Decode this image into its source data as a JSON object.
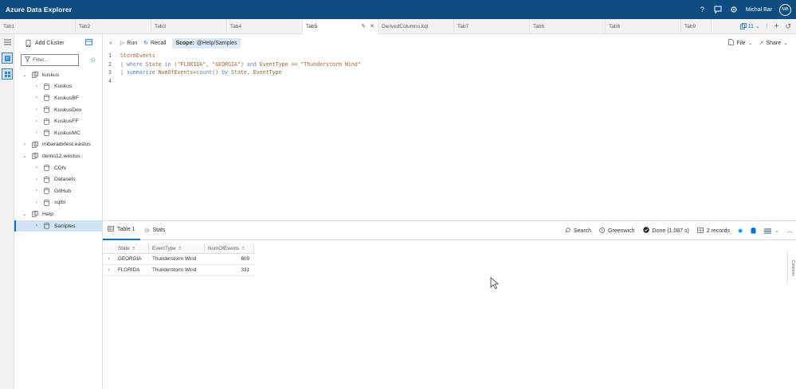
{
  "app": {
    "title": "Azure Data Explorer",
    "user_name": "Michal Bar",
    "user_initials": "MB"
  },
  "header_icons": [
    "help-icon",
    "feedback-icon",
    "settings-icon"
  ],
  "tabs": [
    {
      "label": "Tab1"
    },
    {
      "label": "Tab2"
    },
    {
      "label": "Tab3"
    },
    {
      "label": "Tab4"
    },
    {
      "label": "Tab5"
    },
    {
      "label": "DerivedColumns.kql"
    },
    {
      "label": "Tab7"
    },
    {
      "label": "Tab6"
    },
    {
      "label": "Tab8"
    },
    {
      "label": "Tab9"
    }
  ],
  "tab_tools": {
    "count": "11"
  },
  "connections": {
    "add_cluster_label": "Add Cluster",
    "filter_placeholder": "Filter...",
    "tree": [
      {
        "label": "kuskus",
        "level": 0,
        "expanded": true,
        "kind": "cluster"
      },
      {
        "label": "Kuskus",
        "level": 1,
        "expanded": false,
        "kind": "db"
      },
      {
        "label": "KuskusBF",
        "level": 1,
        "expanded": false,
        "kind": "db"
      },
      {
        "label": "KuskusDev",
        "level": 1,
        "expanded": false,
        "kind": "db"
      },
      {
        "label": "KuskusFF",
        "level": 1,
        "expanded": false,
        "kind": "db"
      },
      {
        "label": "KuskusMC",
        "level": 1,
        "expanded": false,
        "kind": "db"
      },
      {
        "label": "mibaradxtest.eastus",
        "level": 0,
        "expanded": false,
        "kind": "cluster"
      },
      {
        "label": "demo12.westus",
        "level": 0,
        "expanded": true,
        "kind": "cluster"
      },
      {
        "label": "CDN",
        "level": 1,
        "expanded": false,
        "kind": "db"
      },
      {
        "label": "Datasets",
        "level": 1,
        "expanded": false,
        "kind": "db"
      },
      {
        "label": "GitHub",
        "level": 1,
        "expanded": false,
        "kind": "db"
      },
      {
        "label": "sqlbi",
        "level": 1,
        "expanded": false,
        "kind": "db"
      },
      {
        "label": "Help",
        "level": 0,
        "expanded": true,
        "kind": "cluster"
      },
      {
        "label": "Samples",
        "level": 1,
        "expanded": false,
        "kind": "db",
        "selected": true
      }
    ]
  },
  "toolbar": {
    "run_label": "Run",
    "recall_label": "Recall",
    "scope_prefix": "Scope:",
    "scope_value": "@Help/Samples",
    "file_label": "File",
    "share_label": "Share"
  },
  "editor": {
    "lines": [
      {
        "num": "1",
        "tokens": [
          {
            "t": "StormEvents",
            "c": "kw-t"
          }
        ]
      },
      {
        "num": "2",
        "tokens": [
          {
            "t": "| ",
            "c": "kw-o"
          },
          {
            "t": "where",
            "c": "kw-k"
          },
          {
            "t": " State ",
            "c": "kw-o"
          },
          {
            "t": "in",
            "c": "kw-k"
          },
          {
            "t": " (",
            "c": "kw-o"
          },
          {
            "t": "\"FLORIDA\"",
            "c": "kw-s"
          },
          {
            "t": ", ",
            "c": "kw-o"
          },
          {
            "t": "\"GEORGIA\"",
            "c": "kw-s"
          },
          {
            "t": ") ",
            "c": "kw-o"
          },
          {
            "t": "and",
            "c": "kw-k"
          },
          {
            "t": " EventType == ",
            "c": "kw-o"
          },
          {
            "t": "\"Thunderstorm Wind\"",
            "c": "kw-s"
          }
        ]
      },
      {
        "num": "3",
        "tokens": [
          {
            "t": "| ",
            "c": "kw-o"
          },
          {
            "t": "summarize",
            "c": "kw-k"
          },
          {
            "t": " NumOfEvents=",
            "c": "kw-o"
          },
          {
            "t": "count",
            "c": "kw-f"
          },
          {
            "t": "() ",
            "c": "kw-o"
          },
          {
            "t": "by",
            "c": "kw-k"
          },
          {
            "t": " State, EventType",
            "c": "kw-o"
          }
        ]
      },
      {
        "num": "4",
        "tokens": []
      }
    ]
  },
  "results": {
    "tabs": [
      {
        "label": "Table 1"
      },
      {
        "label": "Stats"
      }
    ],
    "search_label": "Search",
    "timezone_label": "Greenwich",
    "status_label": "Done (1.087 s)",
    "records_label": "2 records",
    "columns_pane_label": "Columns",
    "columns": [
      "State",
      "EventType",
      "NumOfEvents"
    ],
    "rows": [
      [
        "GEORGIA",
        "Thunderstorm Wind",
        "609"
      ],
      [
        "FLORIDA",
        "Thunderstorm Wind",
        "331"
      ]
    ]
  },
  "colors": {
    "header": "#0f4c81",
    "accent": "#0078d4",
    "selection": "#cfe3f5"
  }
}
